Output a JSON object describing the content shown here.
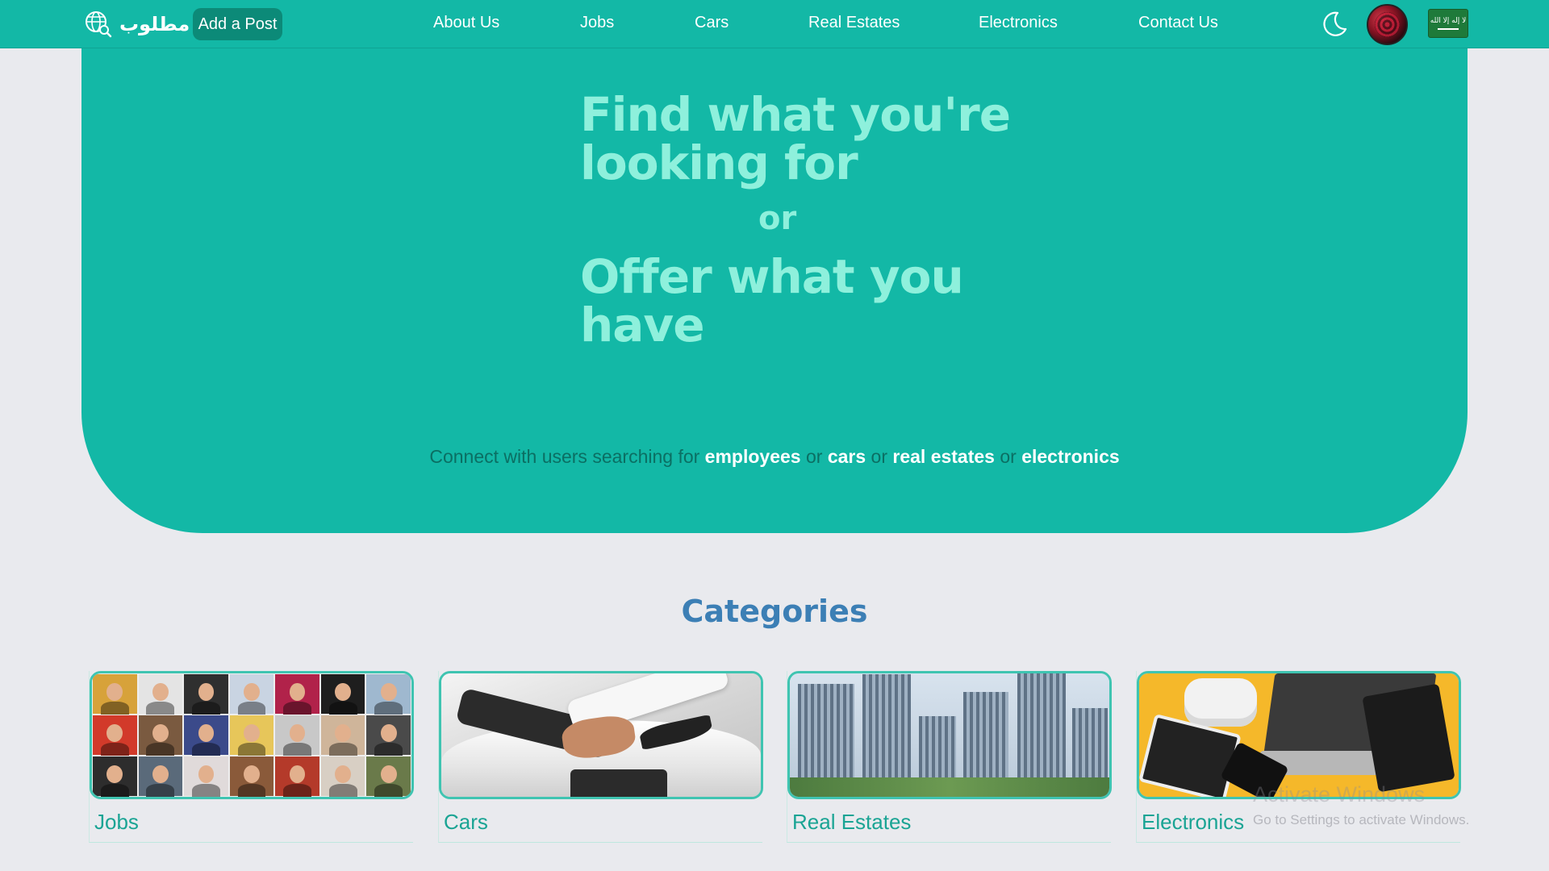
{
  "nav": {
    "logo_text": "مطلوب",
    "add_post": "Add a Post",
    "links": [
      "About Us",
      "Jobs",
      "Cars",
      "Real Estates",
      "Electronics",
      "Contact Us"
    ],
    "flag_text": "لا إله إلا الله",
    "icons": [
      "globe-search-icon",
      "moon-icon",
      "user-avatar",
      "saudi-flag"
    ]
  },
  "hero": {
    "line1": "Find what you're",
    "line2": "looking for",
    "or": "or",
    "line3": "Offer what you",
    "line4": "have",
    "connect_prefix": "Connect with users searching for",
    "keywords": [
      "employees",
      "cars",
      "real estates",
      "electronics"
    ],
    "separator": "or"
  },
  "categories": {
    "title": "Categories",
    "items": [
      {
        "label": "Jobs",
        "image": "people-collage"
      },
      {
        "label": "Cars",
        "image": "handshake-car"
      },
      {
        "label": "Real Estates",
        "image": "city-skyline"
      },
      {
        "label": "Electronics",
        "image": "gadgets-flatlay"
      }
    ]
  },
  "watermark": {
    "title": "Activate Windows",
    "subtitle": "Go to Settings to activate Windows."
  },
  "colors": {
    "brand": "#13b8a6",
    "hero_text": "#8ef0dc",
    "button": "#0c8a78",
    "category_title": "#3c7fb5",
    "background": "#e9eaee"
  }
}
